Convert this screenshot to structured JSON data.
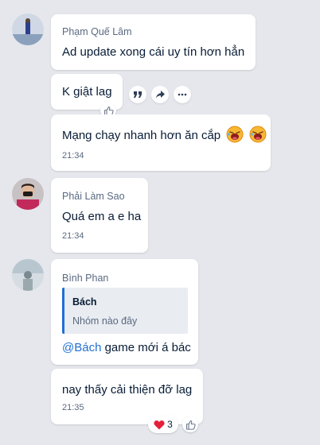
{
  "messages": [
    {
      "sender": "Phạm Quế Lâm",
      "lines": [
        "Ad update xong cái uy tín hơn hẳn",
        "K giật lag",
        "Mạng chạy nhanh hơn ăn cắp"
      ],
      "time": "21:34"
    },
    {
      "sender": "Phải Làm Sao",
      "text": "Quá em a e ha",
      "time": "21:34"
    },
    {
      "sender": "Bình Phan",
      "quote_title": "Bách",
      "quote_body": "Nhóm nào đây",
      "mention": "@Bách",
      "text_after_mention": " game mới á bác",
      "followup": "nay thấy cải thiện đỡ lag",
      "time": "21:35",
      "reaction_count": "3"
    }
  ],
  "icons": {
    "quote": "quote-icon",
    "share": "share-icon",
    "more": "more-icon",
    "like": "thumbs-up-icon",
    "heart": "heart-icon",
    "laugh": "laughing-face-icon"
  },
  "colors": {
    "mention": "#1f6fd4",
    "heart": "#e5203a",
    "background": "#e5e7ec"
  }
}
